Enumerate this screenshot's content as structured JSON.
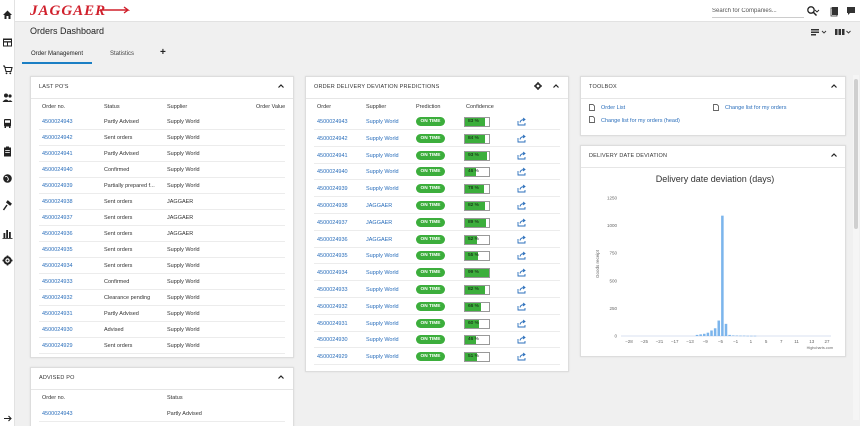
{
  "app": {
    "logo": "JAGGAER"
  },
  "search": {
    "placeholder": "Search for Companies..."
  },
  "page": {
    "title": "Orders Dashboard"
  },
  "tabs": [
    {
      "label": "Order Management"
    },
    {
      "label": "Statistics"
    }
  ],
  "tab_add": "+",
  "last_pos": {
    "title": "LAST PO'S",
    "columns": [
      "Order no.",
      "Status",
      "Supplier",
      "Order Value"
    ],
    "rows": [
      {
        "order": "4500024943",
        "status": "Partly Advised",
        "supplier": "Supply World"
      },
      {
        "order": "4500024942",
        "status": "Sent orders",
        "supplier": "Supply World"
      },
      {
        "order": "4500024941",
        "status": "Partly Advised",
        "supplier": "Supply World"
      },
      {
        "order": "4500024940",
        "status": "Confirmed",
        "supplier": "Supply World"
      },
      {
        "order": "4500024939",
        "status": "Partially prepared f...",
        "supplier": "Supply World"
      },
      {
        "order": "4500024938",
        "status": "Sent orders",
        "supplier": "JAGGAER"
      },
      {
        "order": "4500024937",
        "status": "Sent orders",
        "supplier": "JAGGAER"
      },
      {
        "order": "4500024936",
        "status": "Sent orders",
        "supplier": "JAGGAER"
      },
      {
        "order": "4500024935",
        "status": "Sent orders",
        "supplier": "Supply World"
      },
      {
        "order": "4500024934",
        "status": "Sent orders",
        "supplier": "Supply World"
      },
      {
        "order": "4500024933",
        "status": "Confirmed",
        "supplier": "Supply World"
      },
      {
        "order": "4500024932",
        "status": "Clearance pending",
        "supplier": "Supply World"
      },
      {
        "order": "4500024931",
        "status": "Partly Advised",
        "supplier": "Supply World"
      },
      {
        "order": "4500024930",
        "status": "Advised",
        "supplier": "Supply World"
      },
      {
        "order": "4500024929",
        "status": "Sent orders",
        "supplier": "Supply World"
      }
    ]
  },
  "advised_po": {
    "title": "ADVISED PO",
    "columns": [
      "Order no.",
      "Status"
    ],
    "rows": [
      {
        "order": "4500024943",
        "status": "Partly Advised"
      }
    ]
  },
  "deviation": {
    "title": "ORDER DELIVERY DEVIATION PREDICTIONS",
    "columns": [
      "Order",
      "Supplier",
      "Prediction",
      "Confidence"
    ],
    "prediction_label": "ON TIME",
    "rows": [
      {
        "order": "4500024943",
        "supplier": "Supply World",
        "confidence": 83
      },
      {
        "order": "4500024942",
        "supplier": "Supply World",
        "confidence": 84
      },
      {
        "order": "4500024941",
        "supplier": "Supply World",
        "confidence": 93
      },
      {
        "order": "4500024940",
        "supplier": "Supply World",
        "confidence": 46
      },
      {
        "order": "4500024939",
        "supplier": "Supply World",
        "confidence": 78
      },
      {
        "order": "4500024938",
        "supplier": "JAGGAER",
        "confidence": 82
      },
      {
        "order": "4500024937",
        "supplier": "JAGGAER",
        "confidence": 89
      },
      {
        "order": "4500024936",
        "supplier": "JAGGAER",
        "confidence": 52
      },
      {
        "order": "4500024935",
        "supplier": "Supply World",
        "confidence": 55
      },
      {
        "order": "4500024934",
        "supplier": "Supply World",
        "confidence": 99
      },
      {
        "order": "4500024933",
        "supplier": "Supply World",
        "confidence": 82
      },
      {
        "order": "4500024932",
        "supplier": "Supply World",
        "confidence": 66
      },
      {
        "order": "4500024931",
        "supplier": "Supply World",
        "confidence": 60
      },
      {
        "order": "4500024930",
        "supplier": "Supply World",
        "confidence": 46
      },
      {
        "order": "4500024929",
        "supplier": "Supply World",
        "confidence": 51
      }
    ]
  },
  "toolbox": {
    "title": "TOOLBOX",
    "links": [
      "Order List",
      "Change list for my orders",
      "Change list for my orders (head)"
    ]
  },
  "delivery_chart": {
    "panel_title": "DELIVERY DATE DEVIATION",
    "credits": "Highcharts.com"
  },
  "chart_data": {
    "type": "bar",
    "title": "Delivery date deviation (days)",
    "xlabel": "",
    "ylabel": "Goods receipt",
    "ylim": [
      0,
      1250
    ],
    "yticks": [
      0,
      250,
      500,
      750,
      1000,
      1250
    ],
    "xlim": [
      -29,
      29
    ],
    "xticks": [
      -28,
      -25,
      -21,
      -17,
      -13,
      -9,
      -5,
      -1,
      3,
      7,
      11,
      13,
      17,
      21,
      27
    ],
    "xtick_labels": [
      "-28",
      "-25",
      "-21",
      "-17",
      "-13",
      "-9",
      "-5",
      "-1",
      "1",
      "5",
      "7",
      "11",
      "13",
      "27"
    ],
    "x": [
      -8,
      -7,
      -6,
      -5,
      -4,
      -3,
      -2,
      -1,
      0,
      1,
      2,
      3,
      4,
      5,
      6,
      7,
      8
    ],
    "values": [
      10,
      15,
      20,
      30,
      50,
      70,
      140,
      1090,
      110,
      10,
      5,
      4,
      3,
      3,
      2,
      2,
      2
    ],
    "grid": false,
    "bar_color": "#7cb5ec"
  },
  "colors": {
    "accent": "#1b7fc4",
    "link": "#2a6ebb",
    "on_time": "#3cae3c",
    "brand": "#d0202c"
  }
}
